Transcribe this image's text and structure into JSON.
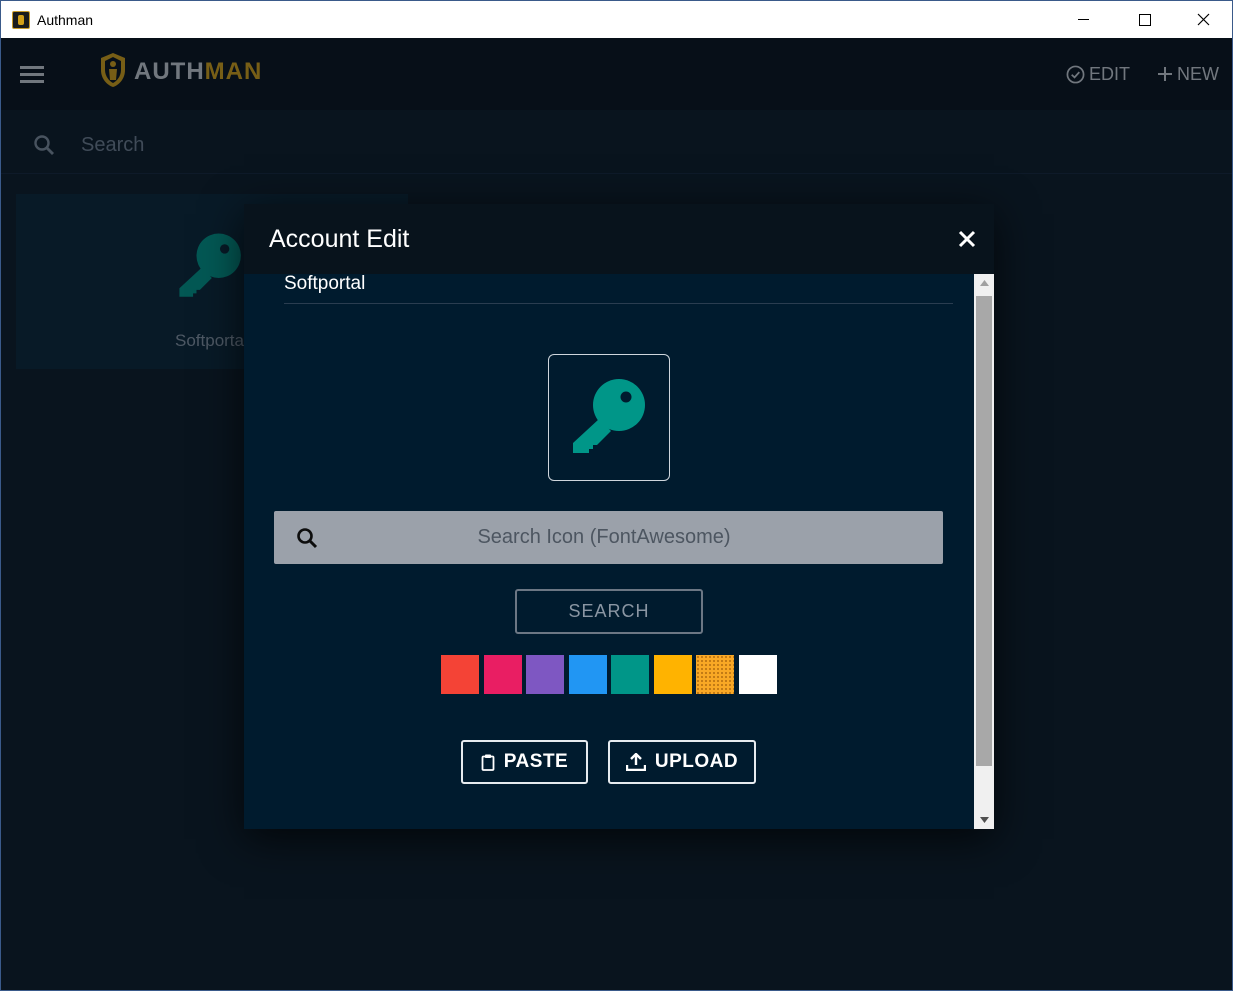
{
  "window": {
    "title": "Authman"
  },
  "header": {
    "logo_part1": "AUTH",
    "logo_part2": "MAN",
    "edit_label": "EDIT",
    "new_label": "NEW"
  },
  "search": {
    "placeholder": "Search"
  },
  "card": {
    "label": "Softportal",
    "icon": "key-icon",
    "icon_color": "#009688"
  },
  "dialog": {
    "title": "Account Edit",
    "name_value": "Softportal",
    "preview_icon": "key-icon",
    "preview_color": "#009688",
    "icon_search_placeholder": "Search Icon (FontAwesome)",
    "search_button_label": "SEARCH",
    "swatches": [
      "#f44336",
      "#e91e63",
      "#7e57c2",
      "#2196f3",
      "#009688",
      "#ffb300",
      "#f9a825",
      "#ffffff"
    ],
    "paste_label": "PASTE",
    "upload_label": "UPLOAD"
  },
  "colors": {
    "accent": "#d4a017",
    "background": "#0c1a26",
    "dialog_background": "#001b2e"
  }
}
